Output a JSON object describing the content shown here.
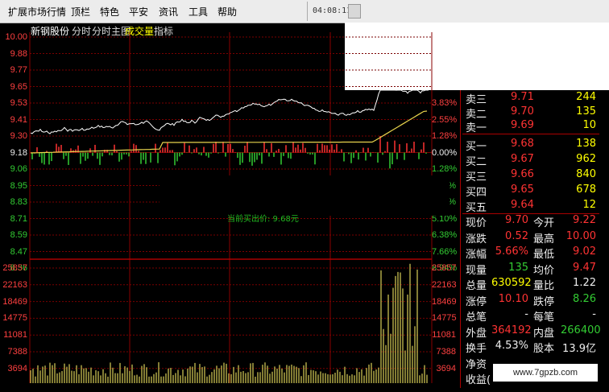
{
  "menu": {
    "items": [
      "扩展市场行情",
      "顶栏",
      "特色",
      "平安",
      "资讯",
      "工具",
      "帮助"
    ],
    "clock": "04:08:11"
  },
  "stock": {
    "name": "新钢股份",
    "tabs": [
      "分时",
      "分时主图",
      "成交量",
      "指标"
    ],
    "active_tab": "成交量"
  },
  "price_axis": {
    "left": [
      "10.00",
      "9.88",
      "9.77",
      "9.65",
      "9.53",
      "9.41",
      "9.30",
      "9.18",
      "9.06",
      "8.95",
      "8.83",
      "8.71",
      "8.59",
      "8.47",
      "8.36"
    ],
    "right": [
      "",
      "",
      "",
      "",
      "3.83%",
      "2.55%",
      "1.28%",
      "0.00%",
      "1.28%",
      "%",
      "%",
      "5.10%",
      "6.38%",
      "7.66%",
      "8.94%"
    ]
  },
  "volume_axis": {
    "left": [
      "25857",
      "22163",
      "18469",
      "14775",
      "11081",
      "7388",
      "3694"
    ],
    "right": [
      "25857",
      "22163",
      "18469",
      "14775",
      "11081",
      "7388",
      "3694"
    ]
  },
  "tooltip": "当前买出价: 9.68元",
  "order_book": {
    "asks": [
      {
        "label": "卖三",
        "price": "9.71",
        "vol": "244"
      },
      {
        "label": "卖二",
        "price": "9.70",
        "vol": "135"
      },
      {
        "label": "卖一",
        "price": "9.69",
        "vol": "10"
      }
    ],
    "bids": [
      {
        "label": "买一",
        "price": "9.68",
        "vol": "138"
      },
      {
        "label": "买二",
        "price": "9.67",
        "vol": "962"
      },
      {
        "label": "买三",
        "price": "9.66",
        "vol": "840"
      },
      {
        "label": "买四",
        "price": "9.65",
        "vol": "678"
      },
      {
        "label": "买五",
        "price": "9.64",
        "vol": "12"
      }
    ]
  },
  "stats": {
    "rows": [
      {
        "l1": "现价",
        "v1": "9.70",
        "l2": "今开",
        "v2": "9.22"
      },
      {
        "l1": "涨跌",
        "v1": "0.52",
        "l2": "最高",
        "v2": "10.00"
      },
      {
        "l1": "涨幅",
        "v1": "5.66%",
        "l2": "最低",
        "v2": "9.02"
      },
      {
        "l1": "现量",
        "v1": "135",
        "l2": "均价",
        "v2": "9.47"
      },
      {
        "l1": "总量",
        "v1": "630592",
        "l2": "量比",
        "v2": "1.22"
      },
      {
        "l1": "涨停",
        "v1": "10.10",
        "l2": "跌停",
        "v2": "8.26"
      },
      {
        "l1": "总笔",
        "v1": "-",
        "l2": "每笔",
        "v2": "-"
      },
      {
        "l1": "外盘",
        "v1": "364192",
        "l2": "内盘",
        "v2": "266400"
      },
      {
        "l1": "换手",
        "v1": "4.53%",
        "l2": "股本",
        "v2": "13.9亿"
      },
      {
        "l1": "净资",
        "v1": "",
        "l2": "",
        "v2": ""
      },
      {
        "l1": "收益(",
        "v1": "",
        "l2": "",
        "v2": ""
      }
    ]
  },
  "colors": {
    "up": "#ff3333",
    "down": "#33cc33",
    "flat": "#eeeeee",
    "grid": "#7a0000",
    "price_line": "#ffffff",
    "avg_line": "#e8d44d",
    "volume": "#c8c050"
  },
  "watermark": "www.7gpzb.com"
}
